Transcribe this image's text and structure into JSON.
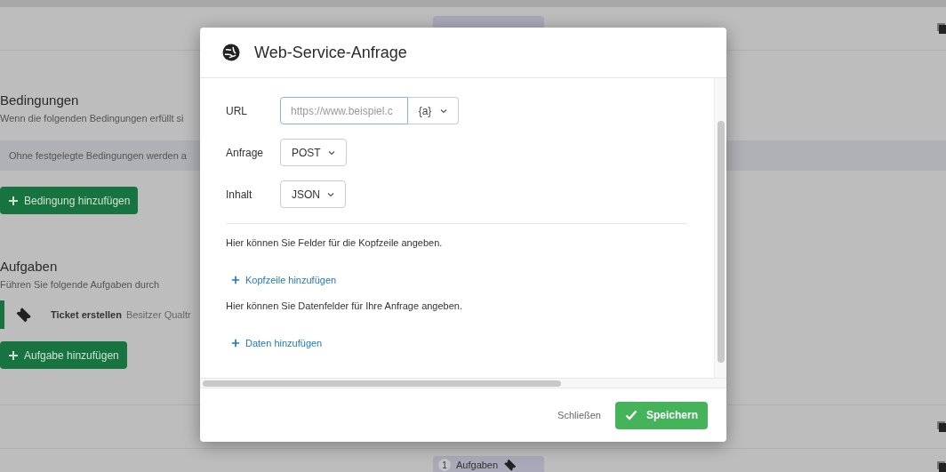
{
  "background": {
    "conditions": {
      "title": "Bedingungen",
      "subtitle": "Wenn die folgenden Bedingungen erfüllt si",
      "notice": "Ohne festgelegte Bedingungen werden a",
      "add_button": "Bedingung hinzufügen"
    },
    "tasks": {
      "title": "Aufgaben",
      "subtitle": "Führen Sie folgende Aufgaben durch",
      "items": [
        {
          "name": "Ticket erstellen",
          "detail": "Besitzer Qualtr"
        }
      ],
      "add_button": "Aufgabe hinzufügen"
    },
    "bottom_badge": {
      "count": "1",
      "label": "Aufgaben"
    }
  },
  "dialog": {
    "title": "Web-Service-Anfrage",
    "fields": [
      {
        "kind": "url",
        "label": "URL",
        "placeholder": "https://www.beispiel.c",
        "addon": "{a}"
      },
      {
        "kind": "select",
        "label": "Anfrage",
        "value": "POST"
      },
      {
        "kind": "select",
        "label": "Inhalt",
        "value": "JSON"
      }
    ],
    "sections": [
      {
        "text": "Hier können Sie Felder für die Kopfzeile angeben.",
        "link": "Kopfzeile hinzufügen"
      },
      {
        "text": "Hier können Sie Datenfelder für Ihre Anfrage angeben.",
        "link": "Daten hinzufügen"
      }
    ],
    "buttons": [
      {
        "kind": "secondary",
        "label": "Schließen"
      },
      {
        "kind": "primary",
        "label": "Speichern"
      }
    ]
  }
}
